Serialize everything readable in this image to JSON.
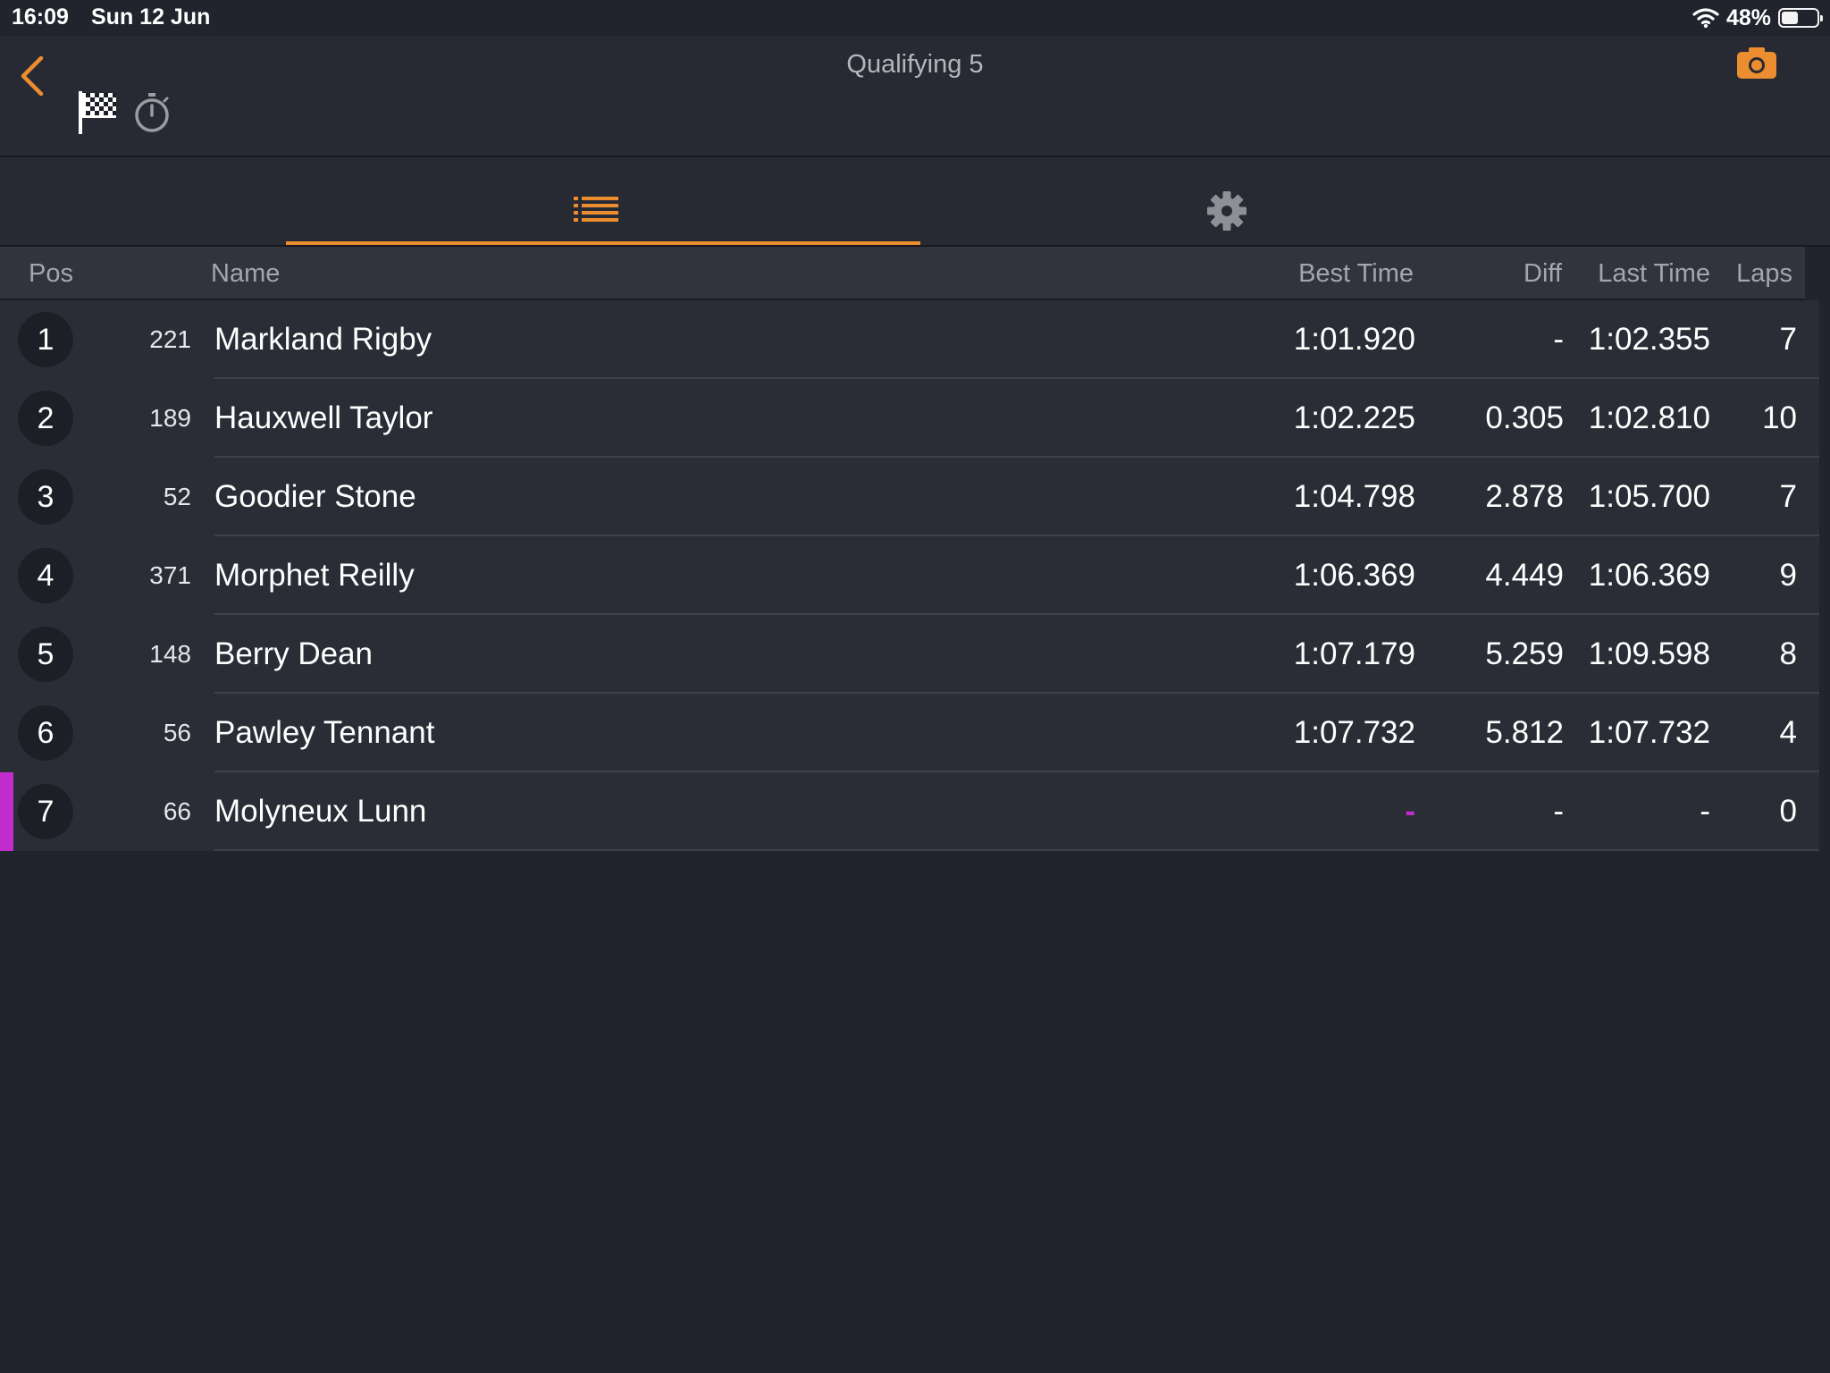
{
  "status": {
    "time": "16:09",
    "date": "Sun 12 Jun",
    "battery": "48%"
  },
  "header": {
    "title": "Qualifying 5"
  },
  "columns": {
    "pos": "Pos",
    "name": "Name",
    "best": "Best Time",
    "diff": "Diff",
    "last": "Last Time",
    "laps": "Laps"
  },
  "rows": [
    {
      "pos": "1",
      "num": "221",
      "name": "Markland Rigby",
      "best": "1:01.920",
      "diff": "-",
      "last": "1:02.355",
      "laps": "7"
    },
    {
      "pos": "2",
      "num": "189",
      "name": "Hauxwell Taylor",
      "best": "1:02.225",
      "diff": "0.305",
      "last": "1:02.810",
      "laps": "10"
    },
    {
      "pos": "3",
      "num": "52",
      "name": "Goodier Stone",
      "best": "1:04.798",
      "diff": "2.878",
      "last": "1:05.700",
      "laps": "7"
    },
    {
      "pos": "4",
      "num": "371",
      "name": "Morphet Reilly",
      "best": "1:06.369",
      "diff": "4.449",
      "last": "1:06.369",
      "laps": "9"
    },
    {
      "pos": "5",
      "num": "148",
      "name": "Berry Dean",
      "best": "1:07.179",
      "diff": "5.259",
      "last": "1:09.598",
      "laps": "8"
    },
    {
      "pos": "6",
      "num": "56",
      "name": "Pawley Tennant",
      "best": "1:07.732",
      "diff": "5.812",
      "last": "1:07.732",
      "laps": "4"
    },
    {
      "pos": "7",
      "num": "66",
      "name": "Molyneux Lunn",
      "best": "-",
      "diff": "-",
      "last": "-",
      "laps": "0"
    }
  ],
  "colors": {
    "accent": "#ec8d2f",
    "highlight": "#c22ccd",
    "background": "#21242d"
  },
  "icons": [
    "back-chevron-icon",
    "camera-icon",
    "checkered-flag-icon",
    "stopwatch-icon",
    "list-icon",
    "gear-icon",
    "wifi-icon",
    "battery-icon"
  ]
}
